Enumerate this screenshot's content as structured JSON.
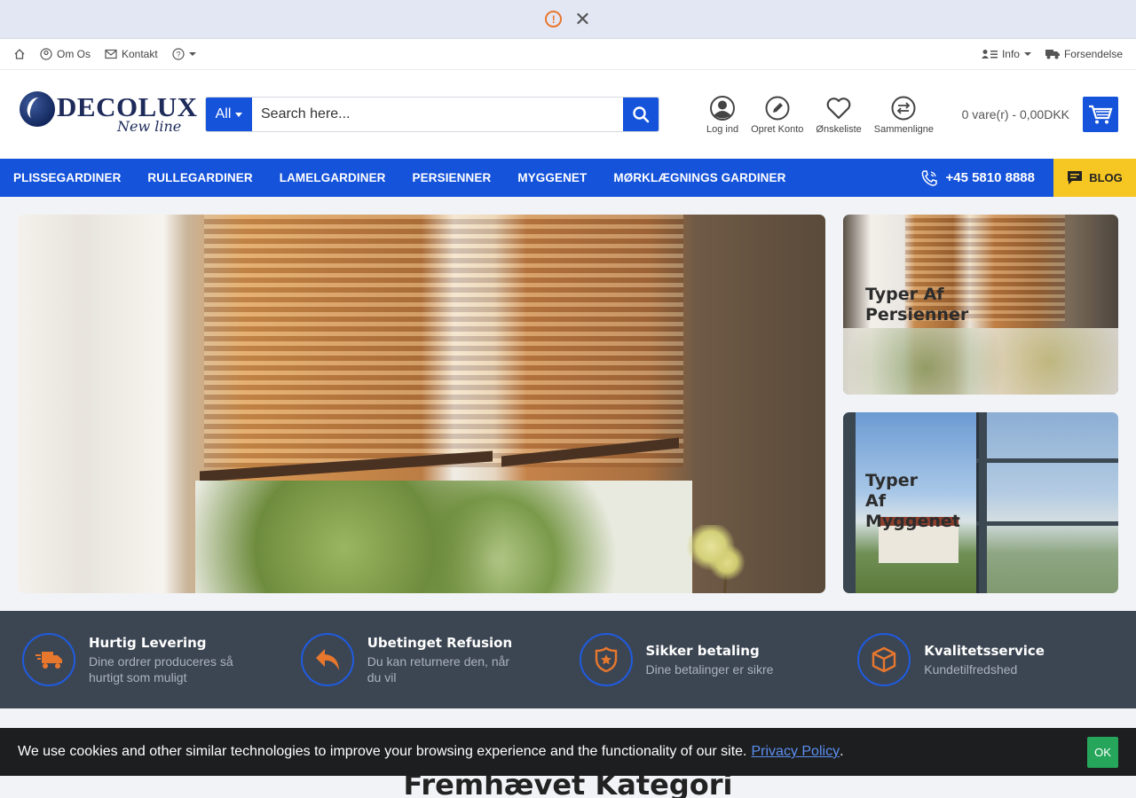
{
  "top_notice": {
    "icon": "alert-icon",
    "close_icon": "close-icon"
  },
  "topbar": {
    "home_icon": "home-icon",
    "about": "Om Os",
    "contact": "Kontakt",
    "help_icon": "help-icon",
    "info": "Info",
    "shipping": "Forsendelse"
  },
  "header": {
    "logo_text": "DECOLUX",
    "logo_tagline": "New line",
    "search": {
      "category": "All",
      "placeholder": "Search here..."
    },
    "account": {
      "login": "Log ind",
      "register": "Opret Konto",
      "wishlist": "Ønskeliste",
      "compare": "Sammenligne"
    },
    "cart": "0 vare(r) - 0,00DKK"
  },
  "nav": {
    "items": [
      "PLISSEGARDINER",
      "RULLEGARDINER",
      "LAMELGARDINER",
      "PERSIENNER",
      "MYGGENET",
      "MØRKLÆGNINGS GARDINER"
    ],
    "phone": "+45 5810 8888",
    "blog": "BLOG"
  },
  "banners": {
    "side1": "Typer Af Persienner",
    "side2": "Typer Af Myggenet"
  },
  "features": [
    {
      "title": "Hurtig Levering",
      "desc": "Dine ordrer produceres så hurtigt som muligt",
      "icon": "truck-icon"
    },
    {
      "title": "Ubetinget Refusion",
      "desc": "Du kan returnere den, når du vil",
      "icon": "return-arrow-icon"
    },
    {
      "title": "Sikker betaling",
      "desc": "Dine betalinger er sikre",
      "icon": "shield-star-icon"
    },
    {
      "title": "Kvalitetsservice",
      "desc": "Kundetilfredshed",
      "icon": "box-icon"
    }
  ],
  "section_title": "Fremhævet Kategori",
  "cookie": {
    "text": "We use cookies and other similar technologies to improve your browsing experience and the functionality of our site.",
    "link": "Privacy Policy",
    "after_link": ".",
    "ok": "OK"
  },
  "colors": {
    "primary": "#1553db",
    "accent": "#f6c623",
    "feature_bg": "#3c4652",
    "feature_icon": "#e8772e"
  }
}
